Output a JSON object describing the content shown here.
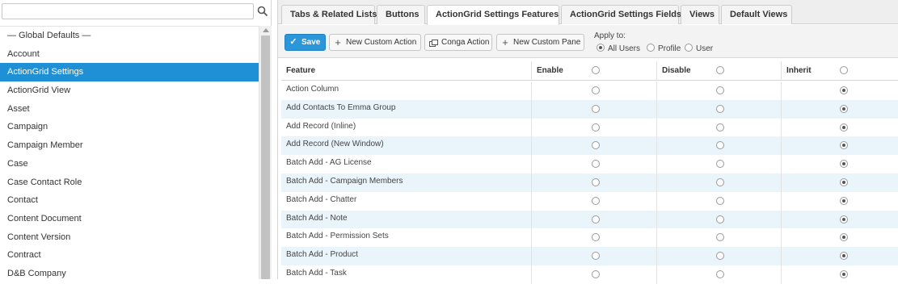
{
  "sidebar": {
    "search": {
      "value": "",
      "placeholder": ""
    },
    "items": [
      {
        "label": "— Global Defaults —",
        "selected": false
      },
      {
        "label": "Account",
        "selected": false
      },
      {
        "label": "ActionGrid Settings",
        "selected": true
      },
      {
        "label": "ActionGrid View",
        "selected": false
      },
      {
        "label": "Asset",
        "selected": false
      },
      {
        "label": "Campaign",
        "selected": false
      },
      {
        "label": "Campaign Member",
        "selected": false
      },
      {
        "label": "Case",
        "selected": false
      },
      {
        "label": "Case Contact Role",
        "selected": false
      },
      {
        "label": "Contact",
        "selected": false
      },
      {
        "label": "Content Document",
        "selected": false
      },
      {
        "label": "Content Version",
        "selected": false
      },
      {
        "label": "Contract",
        "selected": false
      },
      {
        "label": "D&B Company",
        "selected": false
      }
    ]
  },
  "tabs": [
    {
      "label": "Tabs & Related Lists",
      "active": false
    },
    {
      "label": "Buttons",
      "active": false
    },
    {
      "label": "ActionGrid Settings Features",
      "active": true
    },
    {
      "label": "ActionGrid Settings Fields",
      "active": false
    },
    {
      "label": "Views",
      "active": false
    },
    {
      "label": "Default Views",
      "active": false
    }
  ],
  "toolbar": {
    "save_label": "Save",
    "new_custom_action_label": "New Custom Action",
    "conga_action_label": "Conga Action",
    "new_custom_pane_label": "New Custom Pane",
    "apply_to_label": "Apply to:",
    "apply_options": [
      {
        "label": "All Users",
        "checked": true
      },
      {
        "label": "Profile",
        "checked": false
      },
      {
        "label": "User",
        "checked": false
      }
    ]
  },
  "grid": {
    "columns": {
      "feature": "Feature",
      "enable": "Enable",
      "disable": "Disable",
      "inherit": "Inherit"
    },
    "rows": [
      {
        "feature": "Action Column",
        "value": "inherit"
      },
      {
        "feature": "Add Contacts To Emma Group",
        "value": "inherit"
      },
      {
        "feature": "Add Record (Inline)",
        "value": "inherit"
      },
      {
        "feature": "Add Record (New Window)",
        "value": "inherit"
      },
      {
        "feature": "Batch Add - AG License",
        "value": "inherit"
      },
      {
        "feature": "Batch Add - Campaign Members",
        "value": "inherit"
      },
      {
        "feature": "Batch Add - Chatter",
        "value": "inherit"
      },
      {
        "feature": "Batch Add - Note",
        "value": "inherit"
      },
      {
        "feature": "Batch Add - Permission Sets",
        "value": "inherit"
      },
      {
        "feature": "Batch Add - Product",
        "value": "inherit"
      },
      {
        "feature": "Batch Add - Task",
        "value": "inherit"
      }
    ]
  },
  "colors": {
    "accent": "#1f8fd6",
    "save_button": "#2b96d9",
    "row_alt": "#eaf4fb"
  }
}
